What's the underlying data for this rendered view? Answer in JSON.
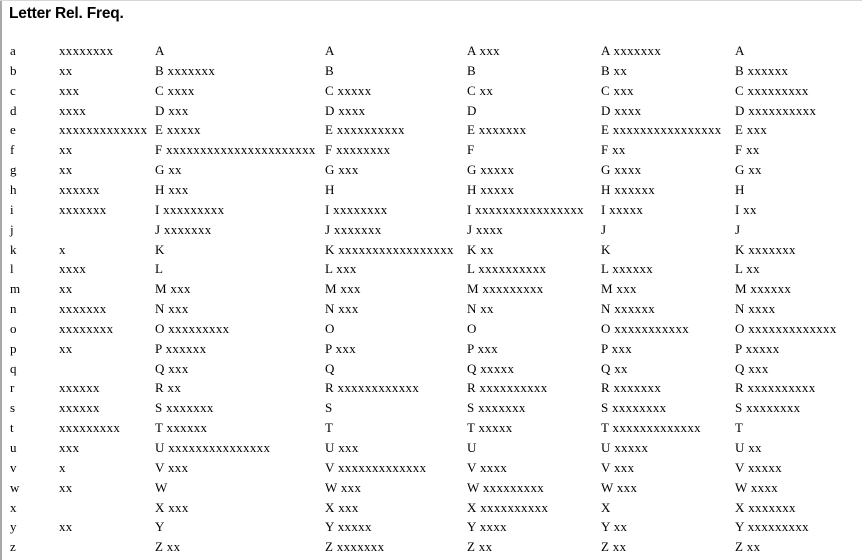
{
  "header": {
    "letter_label": "Letter",
    "freq_label": "Rel. Freq."
  },
  "rows": [
    {
      "letter": "a",
      "freq": "xxxxxxxx",
      "cols": [
        "A",
        "A",
        "A xxx",
        "A xxxxxxx",
        "A"
      ]
    },
    {
      "letter": "b",
      "freq": "xx",
      "cols": [
        "B xxxxxxx",
        "B",
        "B",
        "B xx",
        "B xxxxxx"
      ]
    },
    {
      "letter": "c",
      "freq": "xxx",
      "cols": [
        "C xxxx",
        "C xxxxx",
        "C xx",
        "C xxx",
        "C xxxxxxxxx"
      ]
    },
    {
      "letter": "d",
      "freq": "xxxx",
      "cols": [
        "D xxx",
        "D xxxx",
        "D",
        "D xxxx",
        "D xxxxxxxxxx"
      ]
    },
    {
      "letter": "e",
      "freq": "xxxxxxxxxxxxx",
      "cols": [
        "E xxxxx",
        "E xxxxxxxxxx",
        "E xxxxxxx",
        "E xxxxxxxxxxxxxxxx",
        "E xxx"
      ]
    },
    {
      "letter": "f",
      "freq": "xx",
      "cols": [
        "F xxxxxxxxxxxxxxxxxxxxxx",
        "F xxxxxxxx",
        "F",
        "F xx",
        "F xx"
      ]
    },
    {
      "letter": "g",
      "freq": "xx",
      "cols": [
        "G xx",
        "G xxx",
        "G xxxxx",
        "G xxxx",
        "G xx"
      ]
    },
    {
      "letter": "h",
      "freq": "xxxxxx",
      "cols": [
        "H xxx",
        "H",
        "H xxxxx",
        "H xxxxxx",
        "H"
      ]
    },
    {
      "letter": "i",
      "freq": "xxxxxxx",
      "cols": [
        "I xxxxxxxxx",
        "I xxxxxxxx",
        "I xxxxxxxxxxxxxxxx",
        "I xxxxx",
        "I xx"
      ]
    },
    {
      "letter": "j",
      "freq": "",
      "cols": [
        "J xxxxxxx",
        "J xxxxxxx",
        "J xxxx",
        "J",
        "J"
      ]
    },
    {
      "letter": "k",
      "freq": "x",
      "cols": [
        "K",
        "K xxxxxxxxxxxxxxxxx",
        "K xx",
        "K",
        "K xxxxxxx"
      ]
    },
    {
      "letter": "l",
      "freq": "xxxx",
      "cols": [
        "L",
        "L xxx",
        "L xxxxxxxxxx",
        "L xxxxxx",
        "L xx"
      ]
    },
    {
      "letter": "m",
      "freq": "xx",
      "cols": [
        "M xxx",
        "M xxx",
        "M xxxxxxxxx",
        "M xxx",
        "M xxxxxx"
      ]
    },
    {
      "letter": "n",
      "freq": "xxxxxxx",
      "cols": [
        "N xxx",
        "N xxx",
        "N xx",
        "N xxxxxx",
        "N xxxx"
      ]
    },
    {
      "letter": "o",
      "freq": "xxxxxxxx",
      "cols": [
        "O xxxxxxxxx",
        "O",
        "O",
        "O xxxxxxxxxxx",
        "O xxxxxxxxxxxxx"
      ]
    },
    {
      "letter": "p",
      "freq": "xx",
      "cols": [
        "P xxxxxx",
        "P xxx",
        "P xxx",
        "P xxx",
        "P xxxxx"
      ]
    },
    {
      "letter": "q",
      "freq": "",
      "cols": [
        "Q xxx",
        "Q",
        "Q xxxxx",
        "Q xx",
        "Q xxx"
      ]
    },
    {
      "letter": "r",
      "freq": "xxxxxx",
      "cols": [
        "R xx",
        "R xxxxxxxxxxxx",
        "R xxxxxxxxxx",
        "R xxxxxxx",
        "R xxxxxxxxxx"
      ]
    },
    {
      "letter": "s",
      "freq": "xxxxxx",
      "cols": [
        "S xxxxxxx",
        "S",
        "S xxxxxxx",
        "S xxxxxxxx",
        "S xxxxxxxx"
      ]
    },
    {
      "letter": "t",
      "freq": "xxxxxxxxx",
      "cols": [
        "T xxxxxx",
        "T",
        "T xxxxx",
        "T xxxxxxxxxxxxx",
        "T"
      ]
    },
    {
      "letter": "u",
      "freq": "xxx",
      "cols": [
        "U xxxxxxxxxxxxxxx",
        "U xxx",
        "U",
        "U xxxxx",
        "U xx"
      ]
    },
    {
      "letter": "v",
      "freq": "x",
      "cols": [
        "V xxx",
        "V xxxxxxxxxxxxx",
        "V xxxx",
        "V xxx",
        "V xxxxx"
      ]
    },
    {
      "letter": "w",
      "freq": "xx",
      "cols": [
        "W",
        "W xxx",
        "W xxxxxxxxx",
        "W xxx",
        "W xxxx"
      ]
    },
    {
      "letter": "x",
      "freq": "",
      "cols": [
        "X xxx",
        "X xxx",
        "X xxxxxxxxxx",
        "X",
        "X xxxxxxx"
      ]
    },
    {
      "letter": "y",
      "freq": "xx",
      "cols": [
        "Y",
        "Y xxxxx",
        "Y xxxx",
        "Y xx",
        "Y xxxxxxxxx"
      ]
    },
    {
      "letter": "z",
      "freq": "",
      "cols": [
        "Z xx",
        "Z xxxxxxx",
        "Z xx",
        "Z xx",
        "Z xx"
      ]
    }
  ]
}
